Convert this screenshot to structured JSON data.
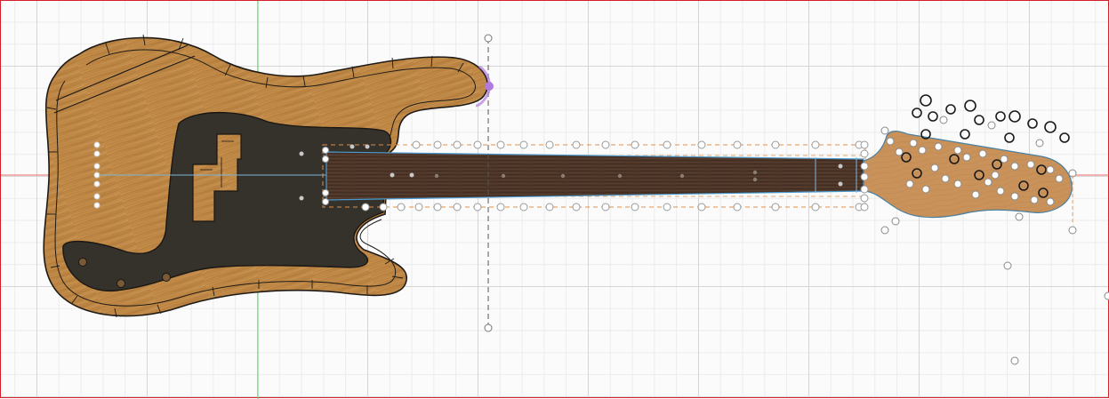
{
  "canvas": {
    "background": "#fbfbfb",
    "frame_color": "#d4202a",
    "grid_major_color": "#d6d6d6",
    "grid_minor_color": "#ececec",
    "axis_x_color": "#e86a6a",
    "axis_y_color": "#6ad36a"
  },
  "model": {
    "body_wood_color": "#c08a48",
    "pickguard_color": "#35312b",
    "fretboard_color": "#4b3427",
    "headstock_color": "#c9925a",
    "construction_line_color": "#e0904a",
    "selection_color": "#4a9ad0",
    "highlight_color": "#b07ae0"
  },
  "icons": {
    "control_point": "control-point-icon",
    "tuner_peg": "tuner-peg-icon",
    "highlight_handle": "sketch-point-highlight-icon"
  }
}
